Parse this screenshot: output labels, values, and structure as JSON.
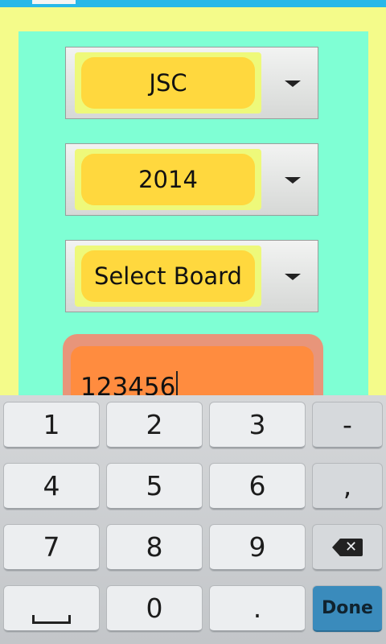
{
  "exam_spinner": {
    "value": "JSC"
  },
  "year_spinner": {
    "value": "2014"
  },
  "board_spinner": {
    "value": "Select Board"
  },
  "roll_input": {
    "value": "123456"
  },
  "keyboard": {
    "keys": [
      "1",
      "2",
      "3",
      "-",
      "4",
      "5",
      "6",
      ",",
      "7",
      "8",
      "9",
      "0",
      "."
    ],
    "done_label": "Done"
  },
  "icons": {
    "dropdown": "triangle-down-icon",
    "backspace": "backspace-icon",
    "space": "space-bar-icon"
  },
  "colors": {
    "background": "#f4fb8a",
    "panel": "#7fffd4",
    "spinner_chip": "#ffd83e",
    "input_fill": "#ff8c3f",
    "done_key": "#3a8bbc",
    "status_bar": "#27b8e9"
  }
}
